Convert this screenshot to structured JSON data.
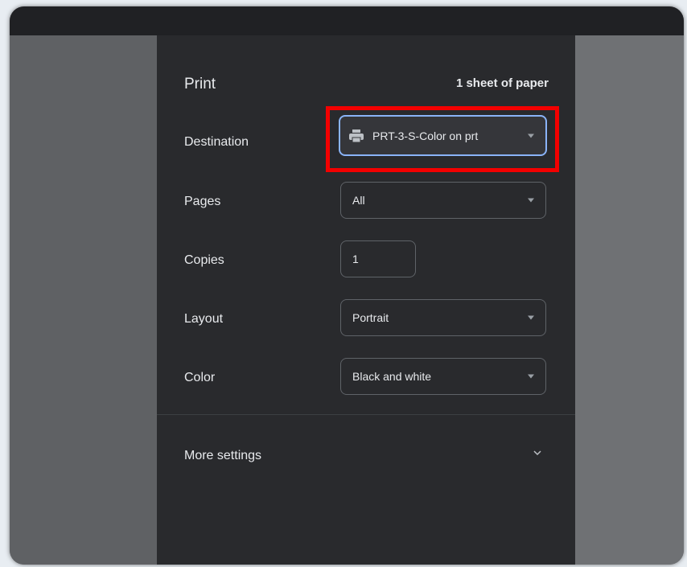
{
  "print": {
    "title": "Print",
    "sheets": "1 sheet of paper",
    "destination": {
      "label": "Destination",
      "value": "PRT-3-S-Color on prt",
      "icon": "printer-icon"
    },
    "pages": {
      "label": "Pages",
      "value": "All"
    },
    "copies": {
      "label": "Copies",
      "value": "1"
    },
    "layout": {
      "label": "Layout",
      "value": "Portrait"
    },
    "color": {
      "label": "Color",
      "value": "Black and white"
    },
    "more_settings": "More settings"
  },
  "colors": {
    "highlight": "#f30000",
    "focus": "#8ab4f8",
    "panel": "#292a2d"
  }
}
